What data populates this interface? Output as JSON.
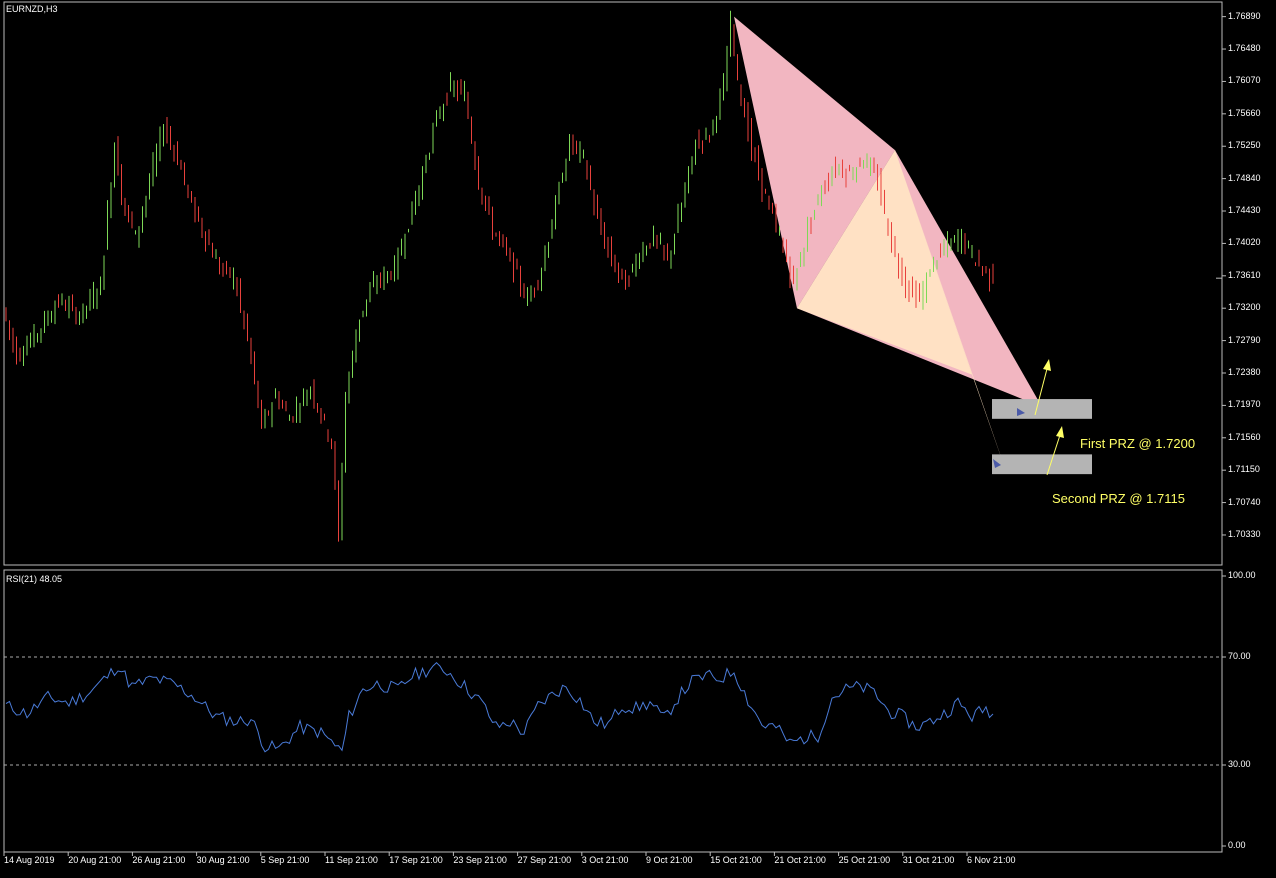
{
  "window": {
    "symbol_label": "EURNZD,H3",
    "rsi_label": "RSI(21) 48.05"
  },
  "chart_data": [
    {
      "type": "candlestick",
      "title": "EURNZD,H3",
      "y_ticks": [
        "1.76890",
        "1.76480",
        "1.76070",
        "1.75660",
        "1.75250",
        "1.74840",
        "1.74430",
        "1.74020",
        "1.73610",
        "1.73200",
        "1.72790",
        "1.72380",
        "1.71970",
        "1.71560",
        "1.71150",
        "1.70740",
        "1.70330"
      ],
      "ylim": [
        1.6995,
        1.7705
      ],
      "x_ticks": [
        "14 Aug 2019",
        "20 Aug 21:00",
        "26 Aug 21:00",
        "30 Aug 21:00",
        "5 Sep 21:00",
        "11 Sep 21:00",
        "17 Sep 21:00",
        "23 Sep 21:00",
        "27 Sep 21:00",
        "3 Oct 21:00",
        "9 Oct 21:00",
        "15 Oct 21:00",
        "21 Oct 21:00",
        "25 Oct 21:00",
        "31 Oct 21:00",
        "6 Nov 21:00"
      ],
      "colors": {
        "up": "#7ed957",
        "down": "#e8413c",
        "background": "#000000"
      },
      "price_path": [
        [
          0,
          1.732
        ],
        [
          2,
          1.726
        ],
        [
          5,
          1.729
        ],
        [
          8,
          1.733
        ],
        [
          11,
          1.731
        ],
        [
          14,
          1.735
        ],
        [
          16,
          1.753
        ],
        [
          17,
          1.746
        ],
        [
          19,
          1.741
        ],
        [
          21,
          1.748
        ],
        [
          23,
          1.755
        ],
        [
          25,
          1.751
        ],
        [
          27,
          1.745
        ],
        [
          29,
          1.741
        ],
        [
          31,
          1.737
        ],
        [
          33,
          1.736
        ],
        [
          35,
          1.728
        ],
        [
          37,
          1.717
        ],
        [
          39,
          1.721
        ],
        [
          41,
          1.718
        ],
        [
          44,
          1.722
        ],
        [
          47,
          1.715
        ],
        [
          48,
          1.703
        ],
        [
          49,
          1.721
        ],
        [
          51,
          1.731
        ],
        [
          53,
          1.735
        ],
        [
          56,
          1.737
        ],
        [
          58,
          1.743
        ],
        [
          60,
          1.749
        ],
        [
          62,
          1.756
        ],
        [
          64,
          1.76
        ],
        [
          66,
          1.759
        ],
        [
          68,
          1.748
        ],
        [
          70,
          1.742
        ],
        [
          72,
          1.739
        ],
        [
          74,
          1.735
        ],
        [
          75,
          1.733
        ],
        [
          77,
          1.737
        ],
        [
          79,
          1.745
        ],
        [
          81,
          1.753
        ],
        [
          83,
          1.751
        ],
        [
          85,
          1.743
        ],
        [
          87,
          1.738
        ],
        [
          89,
          1.735
        ],
        [
          91,
          1.739
        ],
        [
          93,
          1.741
        ],
        [
          95,
          1.738
        ],
        [
          97,
          1.745
        ],
        [
          99,
          1.753
        ],
        [
          101,
          1.754
        ],
        [
          103,
          1.76
        ],
        [
          104,
          1.768
        ],
        [
          105,
          1.761
        ],
        [
          107,
          1.752
        ],
        [
          109,
          1.746
        ],
        [
          111,
          1.741
        ],
        [
          113,
          1.735
        ],
        [
          115,
          1.742
        ],
        [
          117,
          1.747
        ],
        [
          119,
          1.75
        ],
        [
          121,
          1.749
        ],
        [
          123,
          1.751
        ],
        [
          125,
          1.748
        ],
        [
          127,
          1.74
        ],
        [
          129,
          1.735
        ],
        [
          131,
          1.733
        ],
        [
          133,
          1.738
        ],
        [
          135,
          1.74
        ],
        [
          137,
          1.741
        ],
        [
          139,
          1.738
        ],
        [
          141,
          1.736
        ]
      ],
      "patterns": [
        {
          "points": [
            [
              104,
              1.7689
            ],
            [
              113,
              1.732
            ],
            [
              127,
              1.752
            ],
            [
              148,
              1.7195
            ]
          ],
          "color": "#ffc0cb"
        },
        {
          "points": [
            [
              113,
              1.732
            ],
            [
              127,
              1.752
            ],
            [
              138,
              1.7236
            ],
            [
              143,
              1.711
            ]
          ],
          "color": "#ffe4c4"
        }
      ],
      "prz_zones": [
        {
          "label": "First PRZ @ 1.7200",
          "low": 1.718,
          "high": 1.7205
        },
        {
          "label": "Second PRZ @ 1.7115",
          "low": 1.711,
          "high": 1.7135
        }
      ],
      "annotations": [
        "First PRZ @ 1.7200",
        "Second PRZ @ 1.7115"
      ]
    },
    {
      "type": "line",
      "title": "RSI(21) 48.05",
      "ylim": [
        0,
        100
      ],
      "y_ticks": [
        "100.00",
        "70.00",
        "30.00",
        "0.00"
      ],
      "levels": [
        70,
        30
      ],
      "series": [
        {
          "color": "#4a7bd8",
          "path": [
            [
              0,
              52
            ],
            [
              3,
              49
            ],
            [
              6,
              55
            ],
            [
              9,
              53
            ],
            [
              12,
              57
            ],
            [
              15,
              64
            ],
            [
              16,
              67
            ],
            [
              18,
              59
            ],
            [
              21,
              62
            ],
            [
              24,
              60
            ],
            [
              27,
              55
            ],
            [
              30,
              48
            ],
            [
              33,
              46
            ],
            [
              35,
              47
            ],
            [
              37,
              37
            ],
            [
              39,
              36
            ],
            [
              42,
              44
            ],
            [
              45,
              42
            ],
            [
              48,
              35
            ],
            [
              49,
              48
            ],
            [
              51,
              58
            ],
            [
              53,
              60
            ],
            [
              56,
              58
            ],
            [
              58,
              63
            ],
            [
              61,
              66
            ],
            [
              63,
              65
            ],
            [
              66,
              58
            ],
            [
              68,
              53
            ],
            [
              70,
              44
            ],
            [
              72,
              46
            ],
            [
              74,
              42
            ],
            [
              76,
              52
            ],
            [
              78,
              56
            ],
            [
              80,
              59
            ],
            [
              82,
              54
            ],
            [
              84,
              46
            ],
            [
              86,
              45
            ],
            [
              88,
              52
            ],
            [
              90,
              51
            ],
            [
              92,
              53
            ],
            [
              94,
              47
            ],
            [
              96,
              55
            ],
            [
              98,
              61
            ],
            [
              100,
              63
            ],
            [
              102,
              62
            ],
            [
              104,
              65
            ],
            [
              106,
              54
            ],
            [
              108,
              45
            ],
            [
              110,
              44
            ],
            [
              112,
              38
            ],
            [
              114,
              40
            ],
            [
              116,
              41
            ],
            [
              118,
              55
            ],
            [
              120,
              58
            ],
            [
              122,
              59
            ],
            [
              124,
              57
            ],
            [
              126,
              50
            ],
            [
              128,
              48
            ],
            [
              130,
              44
            ],
            [
              132,
              46
            ],
            [
              134,
              49
            ],
            [
              136,
              53
            ],
            [
              138,
              48
            ],
            [
              140,
              51
            ],
            [
              141,
              49
            ]
          ]
        }
      ]
    }
  ]
}
